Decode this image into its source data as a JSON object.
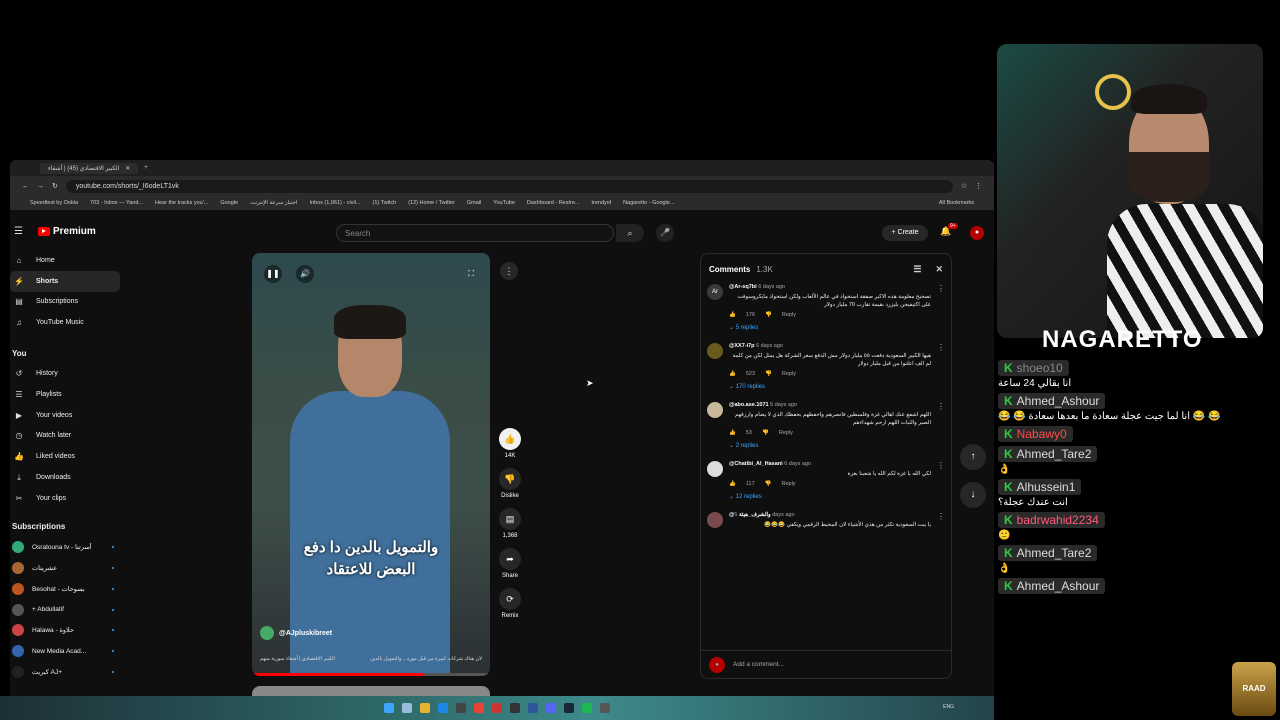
{
  "browser": {
    "tab_title": "الكبير الاقتصادي (45) | أشقاء",
    "url": "youtube.com/shorts/_I6odeLT1vk",
    "bookmarks": [
      "Speedtest by Ookla",
      "703 - Inbox — Yand...",
      "Hear the tracks you'...",
      "Google",
      "اختبار سرعة الإنترنت",
      "Inbox (1,061) - civil...",
      "(1) Twitch",
      "(12) Home / Twitter",
      "Gmail",
      "YouTube",
      "Dashboard - Restre...",
      "trendyol",
      "Nagaretto - Google..."
    ],
    "all_bookmarks": "All Bookmarks"
  },
  "masthead": {
    "logo": "Premium",
    "search_placeholder": "Search",
    "create_label": "Create",
    "notif_badge": "9+"
  },
  "sidebar": {
    "items": [
      {
        "label": "Home",
        "icon": "⌂"
      },
      {
        "label": "Shorts",
        "icon": "⚡"
      },
      {
        "label": "Subscriptions",
        "icon": "▤"
      },
      {
        "label": "YouTube Music",
        "icon": "♫"
      }
    ],
    "you_label": "You",
    "you_items": [
      {
        "label": "History",
        "icon": "↺"
      },
      {
        "label": "Playlists",
        "icon": "☰"
      },
      {
        "label": "Your videos",
        "icon": "▶"
      },
      {
        "label": "Watch later",
        "icon": "◷"
      },
      {
        "label": "Liked videos",
        "icon": "👍"
      },
      {
        "label": "Downloads",
        "icon": "⤓"
      },
      {
        "label": "Your clips",
        "icon": "✂"
      }
    ],
    "subs_label": "Subscriptions",
    "subs": [
      {
        "label": "Osratouna tv - أسرتنا",
        "color": "#3a7"
      },
      {
        "label": "عشرينات",
        "color": "#a63"
      },
      {
        "label": "Besohat - بسوحات",
        "color": "#b52"
      },
      {
        "label": "+ Abdullatif",
        "color": "#555"
      },
      {
        "label": "Halawa - حلاوة",
        "color": "#c44"
      },
      {
        "label": "New Media Acad...",
        "color": "#36a"
      },
      {
        "label": "كبريت AJ+",
        "color": "#222"
      }
    ]
  },
  "video": {
    "subtitle_line1": "والتمويل بالدين دا دفع",
    "subtitle_line2": "البعض للاعتقاد",
    "channel": "@AJpluskibreet",
    "desc_left": "الكبير الاقتصادي | أشقاء سورية منهم",
    "desc_right": "لان هناك شركات كبيرة من قبل مورد... والتمويل بالدين",
    "progress": 0.72
  },
  "actions": {
    "like_count": "14K",
    "dislike_label": "Dislike",
    "comment_count": "1,368",
    "share_label": "Share",
    "remix_label": "Remix"
  },
  "comments_panel": {
    "title": "Comments",
    "count": "1.3K",
    "reply_label": "Reply",
    "add_placeholder": "Add a comment...",
    "items": [
      {
        "user": "@Ar-sq7bi",
        "time": "6 days ago",
        "text": "تصحيح معلومة هذه الاكبر صفقة استحواذ في عالم الألعاب ولكن استحواذ مايكروسوفت على اكتيفيجن بليزرد بقيمة تقارب 70 مليار دولار",
        "likes": "176",
        "replies": "5 replies",
        "avatar": "Ar",
        "color": "#3a3a3a"
      },
      {
        "user": "@XX7-i7p",
        "time": "6 days ago",
        "text": "هيها الكبير السعودية دفعت ٥٥ مليار دولار مش الدفع سعر الشركة هل يمثل لكن من كلمة لم الف اعلنوا من قبل مليار دولار",
        "likes": "523",
        "replies": "170 replies",
        "avatar": "",
        "color": "#6b5a1e"
      },
      {
        "user": "@abo.ase.1071",
        "time": "5 days ago",
        "text": "اللهم اشفع عنك اهالي غزة وفلسطين فانصرهم واحفظهم بحفظك الذي لا يضام وارزقهم الصبر والثبات اللهم ارحم شهداءهم",
        "likes": "53",
        "replies": "2 replies",
        "avatar": "",
        "color": "#c8b79a"
      },
      {
        "user": "@Chatibi_Al_Hasani",
        "time": "6 days ago",
        "text": "لكي الله يا غزة لكم الله يا شعبنا بغزة",
        "likes": "117",
        "replies": "12 replies",
        "avatar": "",
        "color": "#ddd"
      },
      {
        "user": "@والشرف_هيئة",
        "time": "5 days ago",
        "text": "يا بيت السعودية تكثر من هذي الأشياء لان المحيط الرقمي ويكفي 😂😂😂",
        "likes": "",
        "replies": "",
        "avatar": "",
        "color": "#7a4a4a"
      }
    ]
  },
  "stream": {
    "name": "NAGARETTO",
    "chat": [
      {
        "user": "shoeo10",
        "text": "انا بقالي 24 ساعة",
        "color": "#888"
      },
      {
        "user": "Ahmed_Ashour",
        "text": "😂 😂 انا لما جيت عجلة سعادة ما بعدها سعادة 😂 😂",
        "color": "#ddd"
      },
      {
        "user": "Nabawy0",
        "text": "",
        "color": "#ff4b4b"
      },
      {
        "user": "Ahmed_Tare2",
        "text": "👌",
        "color": "#ddd"
      },
      {
        "user": "Alhussein1",
        "text": "انت عندك عجلة؟",
        "color": "#ddd"
      },
      {
        "user": "badrwahid2234",
        "text": "🙂",
        "color": "#ff5b7a"
      },
      {
        "user": "Ahmed_Tare2",
        "text": "👌",
        "color": "#ddd"
      },
      {
        "user": "Ahmed_Ashour",
        "text": "",
        "color": "#ddd"
      }
    ],
    "badge": "RAAD"
  },
  "taskbar": {
    "lang": "ENG"
  }
}
